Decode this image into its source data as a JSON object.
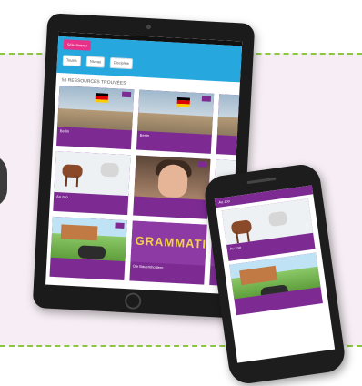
{
  "tablet": {
    "select_button": "Sélectionner",
    "filters": [
      "Toutes",
      "Niveau",
      "Discipline"
    ],
    "result_count": "55 RESSOURCES TROUVÉES",
    "cards": [
      {
        "caption": "Berlin"
      },
      {
        "caption": "Berlin"
      },
      {
        "caption": ""
      },
      {
        "caption": "Au zoo"
      },
      {
        "caption": ""
      },
      {
        "caption": ""
      },
      {
        "caption": ""
      },
      {
        "caption": "Die Bauernhoftiere"
      },
      {
        "caption": ""
      }
    ],
    "grammar_word": "GRAMMATIK"
  },
  "phone": {
    "header": "Au zoo",
    "cards": [
      {
        "caption": "Au zoo"
      },
      {
        "caption": ""
      }
    ]
  },
  "colors": {
    "accent": "#e8328a",
    "header": "#26a8df",
    "card": "#7d2b93",
    "dash": "#8cc63f"
  }
}
